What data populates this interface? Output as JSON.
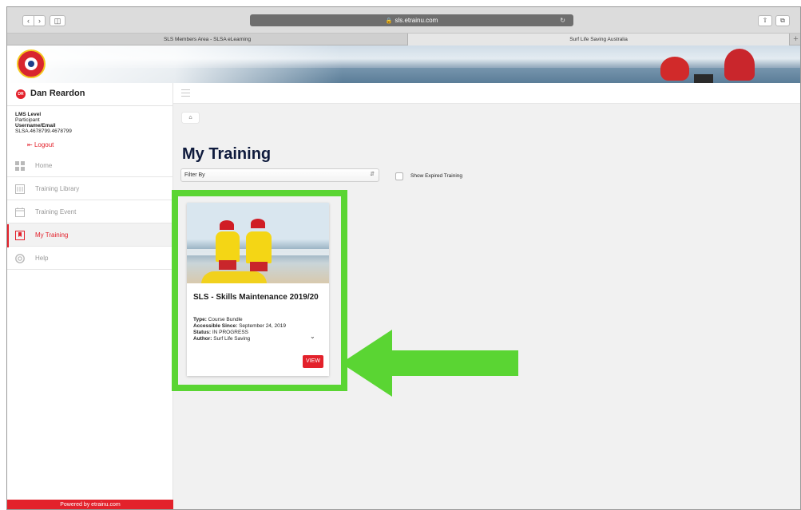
{
  "browser": {
    "url": "sls.etrainu.com",
    "tabs": [
      {
        "label": "SLS Members Area - SLSA eLearning"
      },
      {
        "label": "Surf Life Saving Australia"
      }
    ]
  },
  "user": {
    "initials": "DR",
    "name": "Dan Reardon",
    "lms_level_label": "LMS Level",
    "lms_level_value": "Participant",
    "username_label": "Username/Email",
    "username_value": "SLSA.4678799.4678799",
    "logout_label": "Logout"
  },
  "sidebar": {
    "items": [
      {
        "label": "Home",
        "icon": "dashboard-icon"
      },
      {
        "label": "Training Library",
        "icon": "library-icon"
      },
      {
        "label": "Training Event",
        "icon": "calendar-icon"
      },
      {
        "label": "My Training",
        "icon": "bookmark-icon",
        "active": true
      },
      {
        "label": "Help",
        "icon": "lifebuoy-icon"
      }
    ],
    "powered_by": "Powered by etrainu.com"
  },
  "main": {
    "title": "My Training",
    "filter_placeholder": "Filter By",
    "expired_label": "Show Expired Training"
  },
  "card": {
    "title": "SLS - Skills Maintenance 2019/20",
    "type_label": "Type:",
    "type_value": "Course Bundle",
    "since_label": "Accessible Since:",
    "since_value": "September 24, 2019",
    "status_label": "Status:",
    "status_value": "IN PROGRESS",
    "author_label": "Author:",
    "author_value": "Surf Life Saving",
    "view_label": "VIEW"
  },
  "colors": {
    "accent": "#e3212b",
    "highlight": "#5ad533",
    "title": "#0f1b3d"
  }
}
